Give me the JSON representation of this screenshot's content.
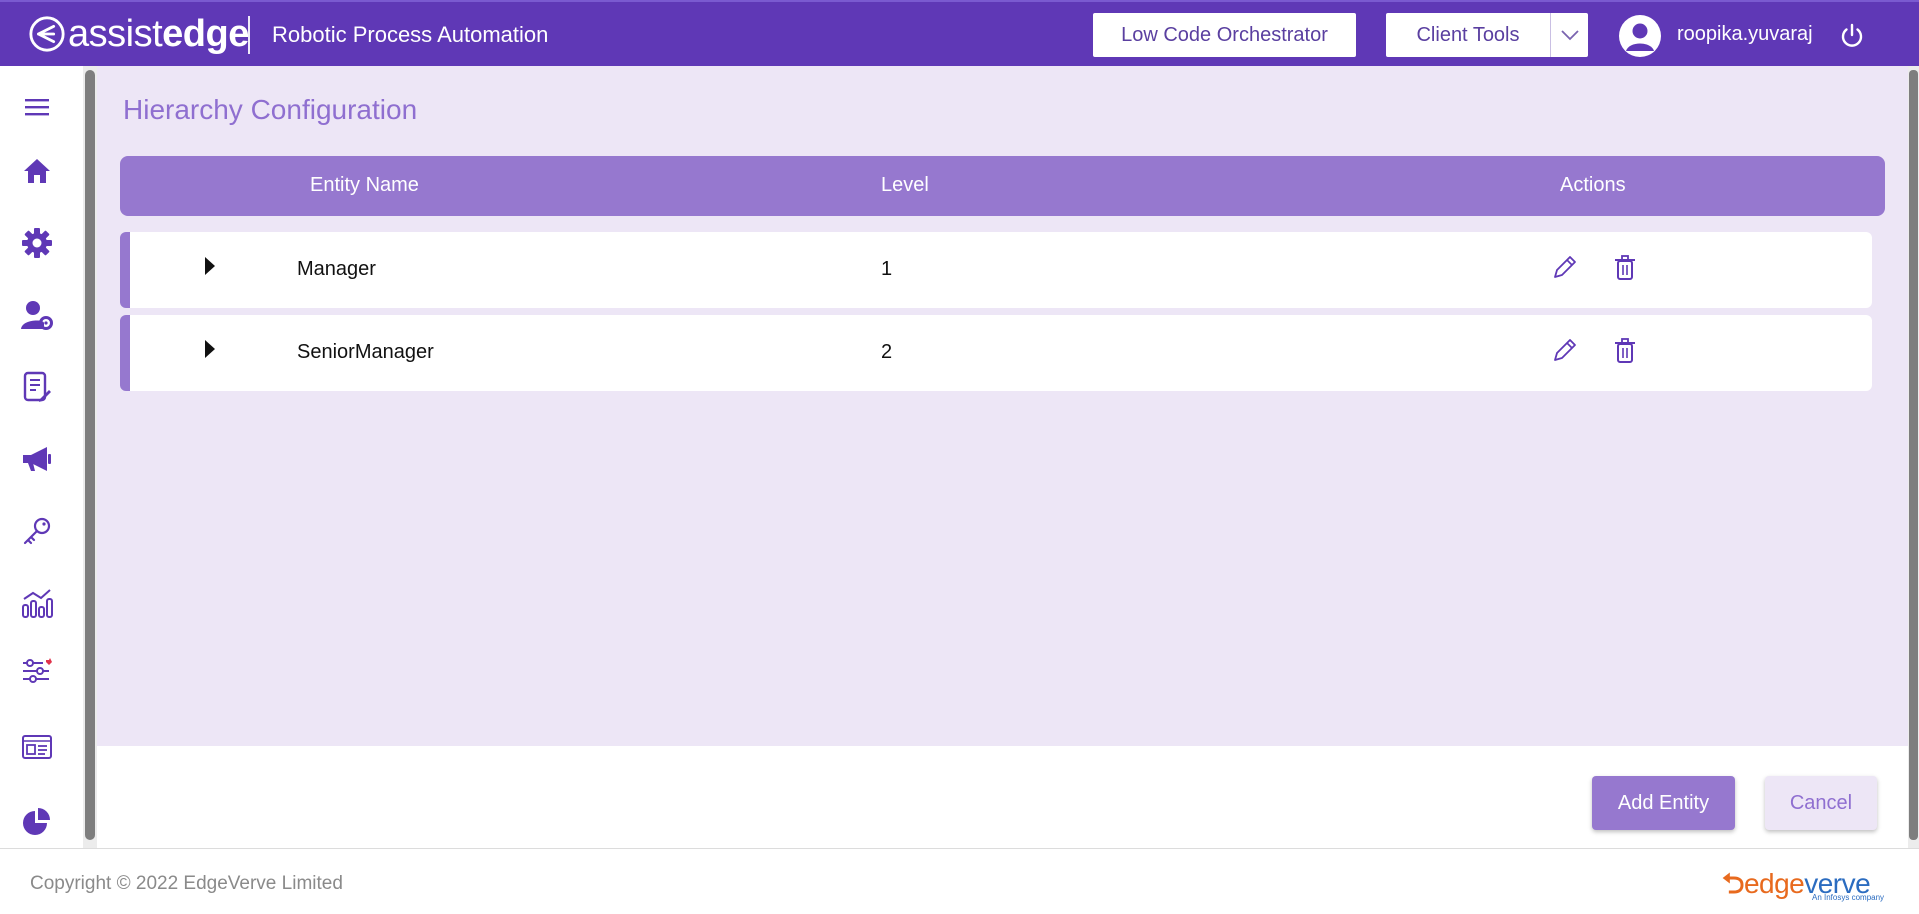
{
  "header": {
    "logo_light": "assist",
    "logo_bold": "edge",
    "product": "Robotic Process Automation",
    "orchestrator_label": "Low Code Orchestrator",
    "client_tools_label": "Client Tools",
    "username": "roopika.yuvaraj"
  },
  "sidebar": {
    "items": [
      {
        "icon": "menu-icon"
      },
      {
        "icon": "home-icon"
      },
      {
        "icon": "gear-icon"
      },
      {
        "icon": "user-settings-icon"
      },
      {
        "icon": "document-edit-icon"
      },
      {
        "icon": "megaphone-icon"
      },
      {
        "icon": "key-icon"
      },
      {
        "icon": "analytics-icon"
      },
      {
        "icon": "filters-icon"
      },
      {
        "icon": "id-card-icon"
      },
      {
        "icon": "pie-chart-icon"
      }
    ]
  },
  "page": {
    "title": "Hierarchy Configuration"
  },
  "table": {
    "columns": [
      "Entity Name",
      "Level",
      "Actions"
    ],
    "rows": [
      {
        "name": "Manager",
        "level": "1"
      },
      {
        "name": "SeniorManager",
        "level": "2"
      }
    ]
  },
  "actions": {
    "add_label": "Add Entity",
    "cancel_label": "Cancel"
  },
  "footer": {
    "copyright": "Copyright © 2022 EdgeVerve Limited",
    "brand_edge": "edge",
    "brand_verve": "verve",
    "brand_tag": "An Infosys company"
  },
  "colors": {
    "brand_purple": "#5f38b6",
    "accent_purple": "#9678cf",
    "content_bg": "#ede6f6",
    "title_purple": "#8f6fd0"
  }
}
